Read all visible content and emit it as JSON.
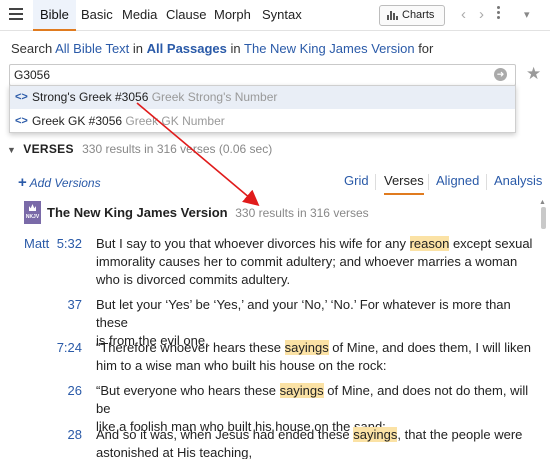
{
  "tabs": [
    "Bible",
    "Basic",
    "Media",
    "Clause",
    "Morph",
    "Syntax"
  ],
  "toolbar": {
    "charts_label": "Charts"
  },
  "search_line": {
    "prefix": "Search",
    "text_scope": "All Bible Text",
    "in1": "in",
    "passages": "All Passages",
    "in2": "in",
    "version": "The New King James Version",
    "suffix": "for"
  },
  "search": {
    "value": "G3056"
  },
  "dropdown": [
    {
      "label": "Strong's Greek #3056",
      "sub": "Greek Strong's Number"
    },
    {
      "label": "Greek GK #3056",
      "sub": "Greek GK Number"
    }
  ],
  "verses_header": {
    "title": "VERSES",
    "meta": "330 results in 316 verses (0.06 sec)"
  },
  "add_versions": "Add Versions",
  "view_tabs": [
    "Grid",
    "Verses",
    "Aligned",
    "Analysis"
  ],
  "active_view": "Verses",
  "version": {
    "badge": "NKJV",
    "title": "The New King James Version",
    "meta": "330 results in 316 verses"
  },
  "results": [
    {
      "book": "Matt",
      "ref": "5:32",
      "lines": [
        [
          {
            "t": "But I say to you that whoever divorces his wife for any "
          },
          {
            "t": "reason",
            "h": true
          },
          {
            "t": " except sexual"
          }
        ],
        [
          {
            "t": "immorality causes her to commit adultery; and whoever marries a woman"
          }
        ],
        [
          {
            "t": "who is divorced commits adultery."
          }
        ]
      ]
    },
    {
      "book": "",
      "ref": "37",
      "lines": [
        [
          {
            "t": "But let your ‘Yes’ be ‘Yes,’ and your ‘No,’ ‘No.’ For whatever is more than these"
          }
        ],
        [
          {
            "t": "is from the evil one."
          }
        ]
      ]
    },
    {
      "book": "",
      "ref": "7:24",
      "lines": [
        [
          {
            "t": "“Therefore whoever hears these "
          },
          {
            "t": "sayings",
            "h": true
          },
          {
            "t": " of Mine, and does them, I will liken"
          }
        ],
        [
          {
            "t": "him to a wise man who built his house on the rock:"
          }
        ]
      ]
    },
    {
      "book": "",
      "ref": "26",
      "lines": [
        [
          {
            "t": "“But everyone who hears these "
          },
          {
            "t": "sayings",
            "h": true
          },
          {
            "t": " of Mine, and does not do them, will be"
          }
        ],
        [
          {
            "t": "like a foolish man who built his house on the sand:"
          }
        ]
      ]
    },
    {
      "book": "",
      "ref": "28",
      "lines": [
        [
          {
            "t": "And so it was, when Jesus had ended these "
          },
          {
            "t": "sayings",
            "h": true
          },
          {
            "t": ", that the people were"
          }
        ],
        [
          {
            "t": "astonished at His teaching,"
          }
        ]
      ]
    }
  ],
  "colors": {
    "accent": "#e07b1f",
    "link": "#2a5aa8",
    "highlight": "#fbe2a5",
    "annotation_arrow": "#e01b1b"
  }
}
